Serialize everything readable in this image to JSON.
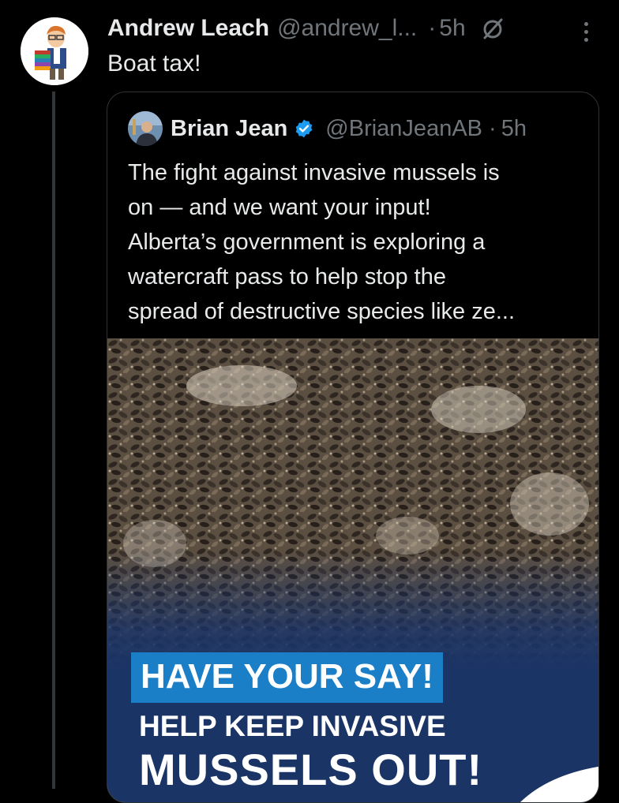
{
  "tweet": {
    "display_name": "Andrew Leach",
    "handle": "@andrew_l...",
    "separator": "·",
    "time": "5h",
    "text": "Boat tax!",
    "grok_icon": "grok-icon",
    "more_icon": "more-options-icon"
  },
  "quote": {
    "display_name": "Brian Jean",
    "verified_icon": "verified-badge-icon",
    "handle": "@BrianJeanAB",
    "separator": "·",
    "time": "5h",
    "lines": [
      "The fight against invasive mussels is",
      "on — and we want your input!",
      "Alberta’s government is exploring a",
      "watercraft pass to help stop the",
      "spread of destructive species like ze..."
    ],
    "media": {
      "description_icon": "mussels-photo",
      "banner_headline": "HAVE YOUR SAY!",
      "banner_line2": "HELP KEEP INVASIVE",
      "banner_line3": "MUSSELS OUT!"
    }
  },
  "colors": {
    "background": "#000000",
    "text": "#e7e9ea",
    "secondary": "#71767b",
    "verified": "#1d9bf0",
    "banner_blue": "#1a7fc7",
    "navy": "#1b3466"
  }
}
